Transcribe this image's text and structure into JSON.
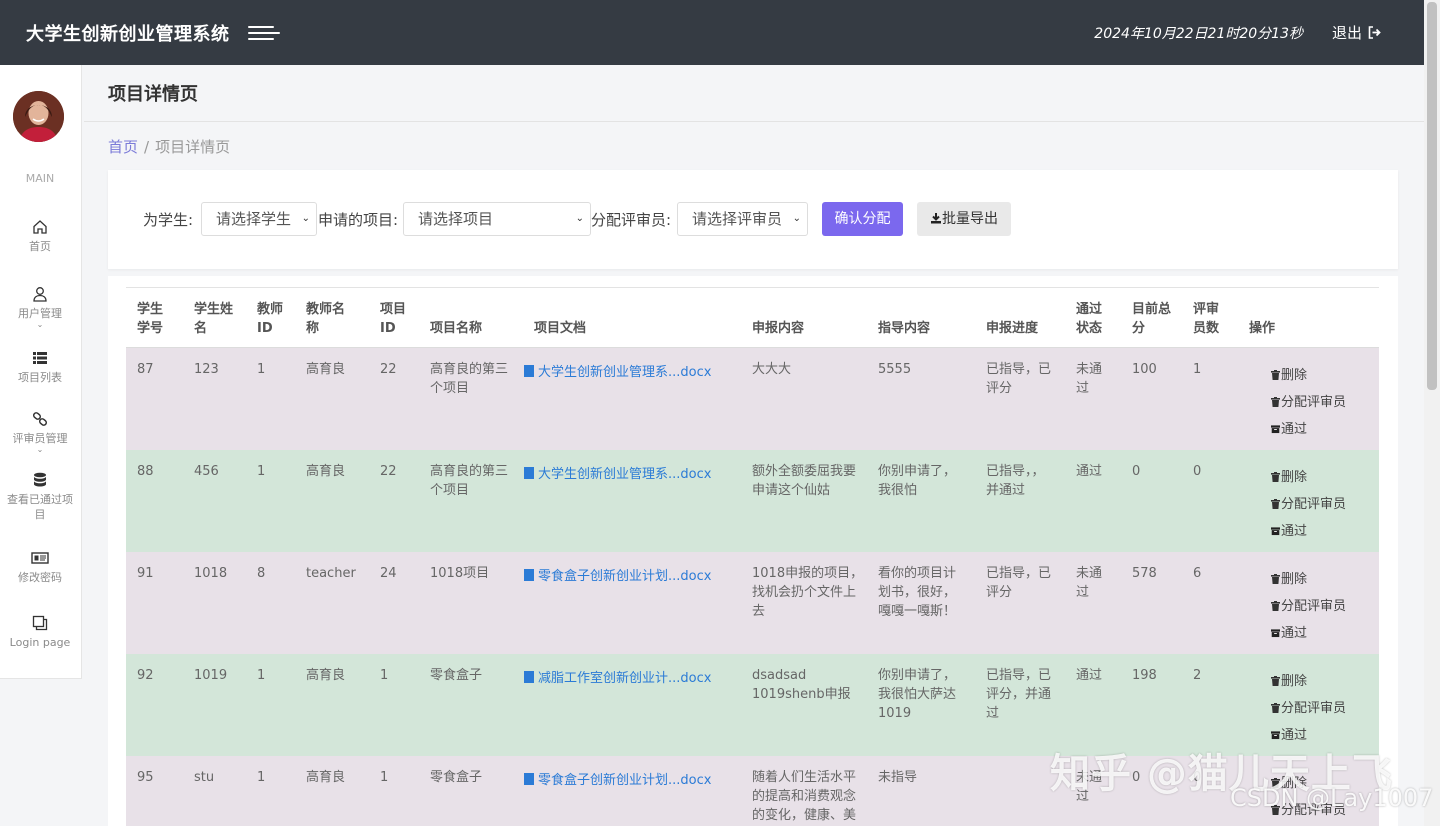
{
  "header": {
    "title": "大学生创新创业管理系统",
    "datetime": "2024年10月22日21时20分13秒",
    "logout": "退出"
  },
  "sidebar": {
    "section": "MAIN",
    "items": [
      {
        "label": "首页",
        "icon": "home-icon"
      },
      {
        "label": "用户管理",
        "icon": "user-icon"
      },
      {
        "label": "项目列表",
        "icon": "list-icon"
      },
      {
        "label": "评审员管理",
        "icon": "link-icon"
      },
      {
        "label": "查看已通过项目",
        "icon": "database-icon"
      },
      {
        "label": "修改密码",
        "icon": "card-icon"
      },
      {
        "label": "Login page",
        "icon": "pages-icon"
      }
    ]
  },
  "page": {
    "title": "项目详情页"
  },
  "breadcrumb": {
    "home": "首页",
    "current": "项目详情页"
  },
  "filter": {
    "student_label": "为学生:",
    "student_select": "请选择学生",
    "project_label": "申请的项目:",
    "project_select": "请选择项目",
    "reviewer_label": "分配评审员:",
    "reviewer_select": "请选择评审员",
    "confirm": "确认分配",
    "export": "批量导出"
  },
  "table": {
    "headers": {
      "sid": [
        "学生",
        "学号"
      ],
      "sname": [
        "学生姓",
        "名"
      ],
      "tid": [
        "教师",
        "ID"
      ],
      "tname": [
        "教师名",
        "称"
      ],
      "pid": [
        "项目",
        "ID"
      ],
      "pname": "项目名称",
      "doc": "项目文档",
      "content": "申报内容",
      "guide": "指导内容",
      "progress": "申报进度",
      "status": [
        "通过",
        "状态"
      ],
      "score": [
        "目前总",
        "分"
      ],
      "reviewers": [
        "评审",
        "员数"
      ],
      "ops": "操作"
    },
    "ops": {
      "delete": "删除",
      "assign": "分配评审员",
      "pass": "通过"
    },
    "rows": [
      {
        "sid": "87",
        "sname": "123",
        "tid": "1",
        "tname": "高育良",
        "pid": "22",
        "pname": [
          "高育良的第三",
          "个项目"
        ],
        "doc": "大学生创新创业管理系...docx",
        "content": [
          "大大大"
        ],
        "guide": [
          "5555"
        ],
        "progress": [
          "已指导，已",
          "评分"
        ],
        "status": [
          "未通",
          "过"
        ],
        "score": "100",
        "reviewers": "1"
      },
      {
        "sid": "88",
        "sname": "456",
        "tid": "1",
        "tname": "高育良",
        "pid": "22",
        "pname": [
          "高育良的第三",
          "个项目"
        ],
        "doc": "大学生创新创业管理系...docx",
        "content": [
          "额外全额委屈我要",
          "申请这个仙姑"
        ],
        "guide": [
          "你别申请了，",
          "我很怕"
        ],
        "progress": [
          "已指导，，",
          "并通过"
        ],
        "status": [
          "通过"
        ],
        "score": "0",
        "reviewers": "0"
      },
      {
        "sid": "91",
        "sname": "1018",
        "tid": "8",
        "tname": "teacher",
        "pid": "24",
        "pname": [
          "1018项目"
        ],
        "doc": "零食盒子创新创业计划...docx",
        "content": [
          "1018申报的项目，",
          "找机会扔个文件上",
          "去"
        ],
        "guide": [
          "看你的项目计",
          "划书，很好，",
          "嘎嘎一嘎斯！"
        ],
        "progress": [
          "已指导，已",
          "评分"
        ],
        "status": [
          "未通",
          "过"
        ],
        "score": "578",
        "reviewers": "6"
      },
      {
        "sid": "92",
        "sname": "1019",
        "tid": "1",
        "tname": "高育良",
        "pid": "1",
        "pname": [
          "零食盒子"
        ],
        "doc": "减脂工作室创新创业计...docx",
        "content": [
          "dsadsad",
          "1019shenb申报"
        ],
        "guide": [
          "你别申请了，",
          "我很怕大萨达",
          "1019"
        ],
        "progress": [
          "已指导，已",
          "评分，并通",
          "过"
        ],
        "status": [
          "通过"
        ],
        "score": "198",
        "reviewers": "2"
      },
      {
        "sid": "95",
        "sname": "stu",
        "tid": "1",
        "tname": "高育良",
        "pid": "1",
        "pname": [
          "零食盒子"
        ],
        "doc": "零食盒子创新创业计划...docx",
        "content": [
          "随着人们生活水平",
          "的提高和消费观念",
          "的变化，健康、美"
        ],
        "guide": [
          "未指导"
        ],
        "progress": [
          ""
        ],
        "status": [
          "未通",
          "过"
        ],
        "score": "0",
        "reviewers": "0"
      }
    ]
  },
  "watermark": {
    "zhihu": "知乎 @猫儿天上飞",
    "csdn": "CSDN @Lay1007"
  },
  "colors": {
    "header_bg": "#353b43",
    "primary": "#7b68ee",
    "link": "#2b7bd6",
    "row_odd": "#e8e1e8",
    "row_even": "#d3e6d9"
  }
}
